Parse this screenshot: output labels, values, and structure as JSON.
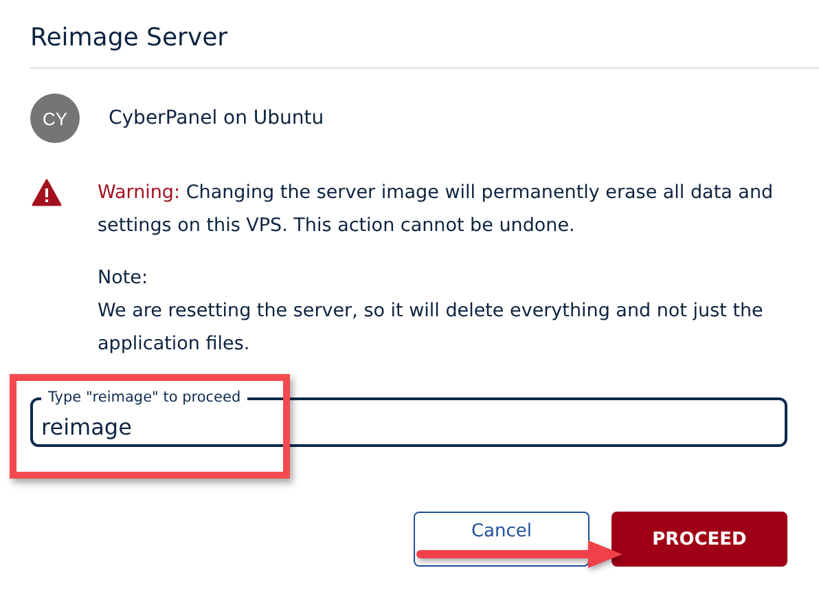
{
  "dialog": {
    "title": "Reimage Server"
  },
  "server": {
    "avatar": "CY",
    "name": "CyberPanel on Ubuntu"
  },
  "warning": {
    "label": "Warning:",
    "text": "Changing the server image will permanently erase all data and settings on this VPS. This action cannot be undone."
  },
  "note": {
    "label": "Note:",
    "text": "We are resetting the server, so it will delete everything and not just the application files."
  },
  "field": {
    "label": "Type \"reimage\" to proceed",
    "value": "reimage"
  },
  "buttons": [
    {
      "label": "Cancel",
      "kind": "secondary"
    },
    {
      "label": "PROCEED",
      "kind": "primary"
    }
  ],
  "annotations": [
    {
      "kind": "box"
    },
    {
      "kind": "arrow"
    }
  ]
}
